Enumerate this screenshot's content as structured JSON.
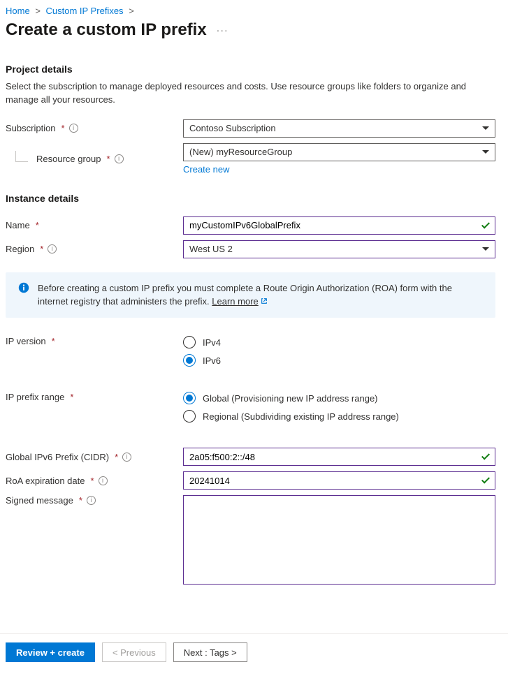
{
  "breadcrumb": {
    "home": "Home",
    "custom_ip": "Custom IP Prefixes"
  },
  "title": "Create a custom IP prefix",
  "project_details": {
    "heading": "Project details",
    "desc": "Select the subscription to manage deployed resources and costs. Use resource groups like folders to organize and manage all your resources.",
    "subscription_label": "Subscription",
    "subscription_value": "Contoso Subscription",
    "rg_label": "Resource group",
    "rg_value": "(New) myResourceGroup",
    "create_new": "Create new"
  },
  "instance_details": {
    "heading": "Instance details",
    "name_label": "Name",
    "name_value": "myCustomIPv6GlobalPrefix",
    "region_label": "Region",
    "region_value": "West US 2"
  },
  "alert": {
    "text": "Before creating a custom IP prefix you must complete a Route Origin Authorization (ROA) form with the internet registry that administers the prefix. ",
    "learn_more": "Learn more"
  },
  "ipversion": {
    "label": "IP version",
    "v4": "IPv4",
    "v6": "IPv6"
  },
  "prefixrange": {
    "label": "IP prefix range",
    "global": "Global (Provisioning new IP address range)",
    "regional": "Regional (Subdividing existing IP address range)"
  },
  "cidr_label": "Global IPv6 Prefix (CIDR)",
  "cidr_value": "2a05:f500:2::/48",
  "roa_label": "RoA expiration date",
  "roa_value": "20241014",
  "signed_label": "Signed message",
  "footer": {
    "review": "Review + create",
    "prev": "< Previous",
    "next": "Next : Tags >"
  }
}
